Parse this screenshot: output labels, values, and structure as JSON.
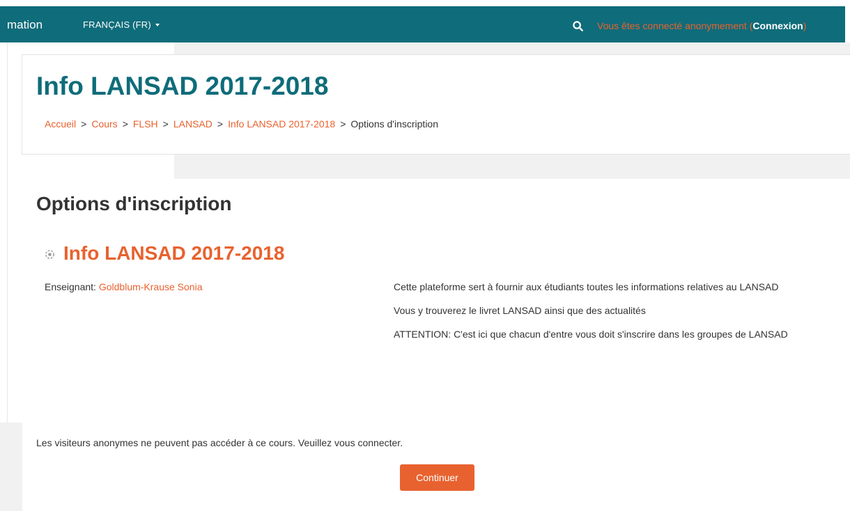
{
  "navbar": {
    "brand": "mation",
    "language": "FRANÇAIS (FR)",
    "login_text": "Vous êtes connecté anonymement (",
    "login_link": "Connexion",
    "login_close": ")",
    "icons": {
      "search": "search-icon",
      "caret": "caret-down-icon"
    }
  },
  "header": {
    "title": "Info LANSAD 2017-2018",
    "breadcrumb": [
      "Accueil",
      "Cours",
      "FLSH",
      "LANSAD",
      "Info LANSAD 2017-2018",
      "Options d'inscription"
    ],
    "breadcrumb_separator": ">"
  },
  "main": {
    "heading": "Options d'inscription",
    "course": {
      "name": "Info LANSAD 2017-2018",
      "icon": "course-icon",
      "teacher_label": "Enseignant: ",
      "teacher_name": "Goldblum-Krause Sonia",
      "summary": [
        "Cette plateforme sert à fournir aux étudiants toutes les informations relatives au LANSAD",
        "Vous y trouverez le livret LANSAD ainsi que des actualités",
        "ATTENTION: C'est ici que chacun d'entre vous doit s'inscrire dans les groupes de LANSAD"
      ]
    },
    "notice": "Les visiteurs anonymes ne peuvent pas accéder à ce cours. Veuillez vous connecter.",
    "continue_label": "Continuer"
  },
  "colors": {
    "navbar": "#0f6c7a",
    "accent": "#e8622f",
    "title": "#0f6c7a",
    "text": "#333333",
    "backdrop": "#f1f1f1"
  }
}
